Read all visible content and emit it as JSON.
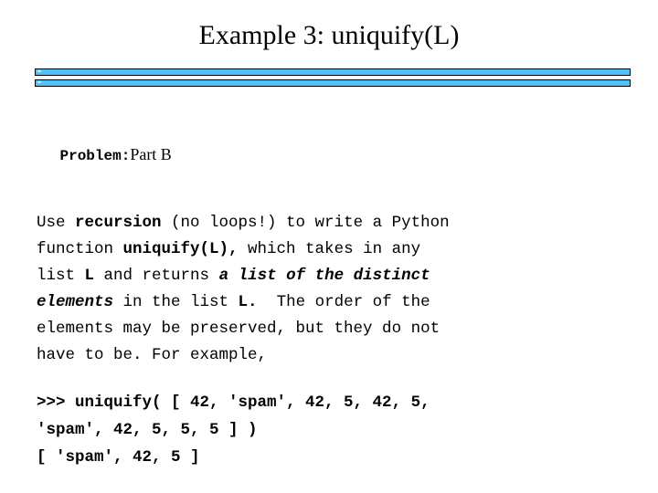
{
  "slide": {
    "title": "Example 3: uniquify(L)",
    "divider": {
      "style": "double-bar",
      "fill_color": "#4FC3F7",
      "border_color": "#000000",
      "highlight_color": "#BFE9FB"
    },
    "problem": {
      "label": "Problem:",
      "value": "Part B"
    },
    "paragraph": {
      "lines": [
        {
          "runs": [
            {
              "text": "Use ",
              "style": "normal"
            },
            {
              "text": "recursion",
              "style": "bold"
            },
            {
              "text": " (no loops!) to write a Python",
              "style": "normal"
            }
          ]
        },
        {
          "runs": [
            {
              "text": "function ",
              "style": "normal"
            },
            {
              "text": "uniquify(L),",
              "style": "bold"
            },
            {
              "text": " which takes in any",
              "style": "normal"
            }
          ]
        },
        {
          "runs": [
            {
              "text": "list ",
              "style": "normal"
            },
            {
              "text": "L",
              "style": "bold"
            },
            {
              "text": " and returns ",
              "style": "normal"
            },
            {
              "text": "a list of the distinct",
              "style": "bold-italic"
            }
          ]
        },
        {
          "runs": [
            {
              "text": "elements",
              "style": "bold-italic"
            },
            {
              "text": " in the list ",
              "style": "normal"
            },
            {
              "text": "L.",
              "style": "bold"
            },
            {
              "text": "  The order of the",
              "style": "normal"
            }
          ]
        },
        {
          "runs": [
            {
              "text": "elements may be preserved, but they do not",
              "style": "normal"
            }
          ]
        },
        {
          "runs": [
            {
              "text": "have to be. For example,",
              "style": "normal"
            }
          ]
        }
      ]
    },
    "code": {
      "lines": [
        ">>> uniquify( [ 42, 'spam', 42, 5, 42, 5,",
        "'spam', 42, 5, 5, 5 ] )",
        "[ 'spam', 42, 5 ]"
      ]
    }
  }
}
